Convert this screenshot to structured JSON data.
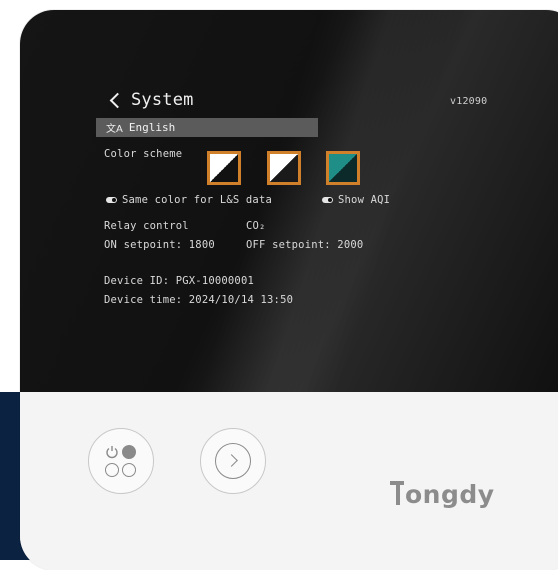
{
  "screen": {
    "title": "System",
    "version": "v12090",
    "language": "English",
    "color_scheme_label": "Color scheme",
    "color_schemes": [
      "light-diagonal",
      "light-dark-diagonal",
      "teal-diagonal"
    ],
    "same_color_label": "Same color for L&S data",
    "show_aqi_label": "Show AQI",
    "relay_label": "Relay control",
    "relay_value": "CO₂",
    "on_setpoint": "ON setpoint: 1800",
    "off_setpoint": "OFF setpoint: 2000",
    "device_id": "Device ID:  PGX-10000001",
    "device_time": "Device time:  2024/10/14 13:50"
  },
  "panel": {
    "brand": "ongdy"
  },
  "colors": {
    "accent": "#d0802b",
    "screen_bg": "#111111",
    "panel_bg": "#f4f4f4",
    "navy": "#0b2240"
  }
}
